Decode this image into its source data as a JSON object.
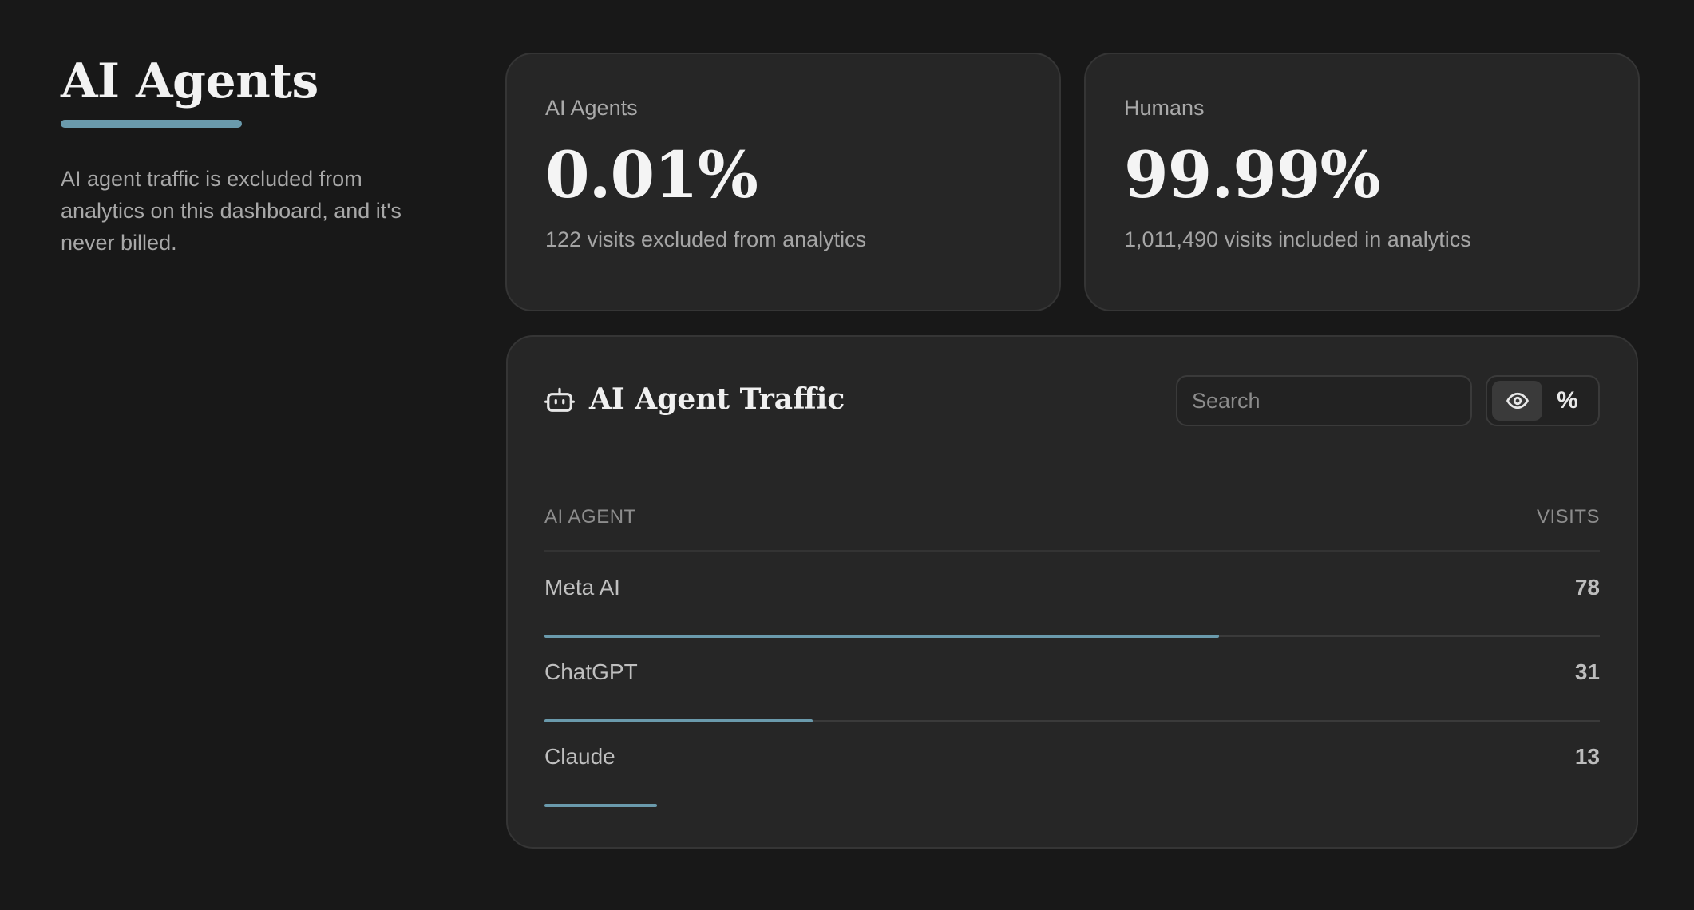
{
  "intro": {
    "title": "AI Agents",
    "description": "AI agent traffic is excluded from analytics on this dashboard, and it's never billed."
  },
  "stats": {
    "agents": {
      "label": "AI Agents",
      "value": "0.01%",
      "sub": "122 visits excluded from analytics"
    },
    "humans": {
      "label": "Humans",
      "value": "99.99%",
      "sub": "1,011,490 visits included in analytics"
    }
  },
  "traffic": {
    "title": "AI Agent Traffic",
    "icon": "robot-icon",
    "search_placeholder": "Search",
    "toggle": {
      "views_icon": "eye-icon",
      "percent_label": "%",
      "active": "views"
    },
    "columns": {
      "agent": "AI AGENT",
      "visits": "VISITS"
    },
    "rows": [
      {
        "name": "Meta AI",
        "visits": "78",
        "share": 0.639
      },
      {
        "name": "ChatGPT",
        "visits": "31",
        "share": 0.254
      },
      {
        "name": "Claude",
        "visits": "13",
        "share": 0.107
      }
    ]
  },
  "colors": {
    "accent": "#6a9aac",
    "background": "#181818",
    "card": "#262626"
  }
}
